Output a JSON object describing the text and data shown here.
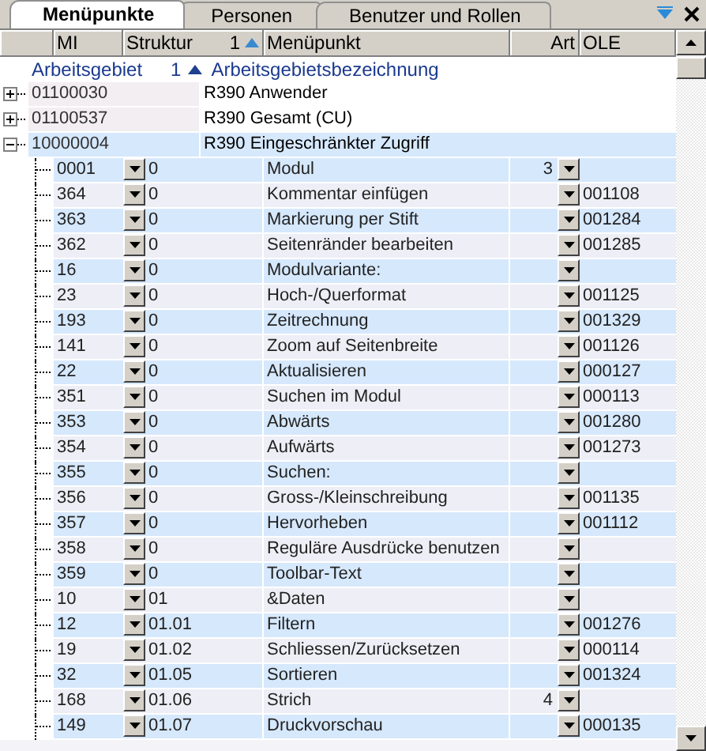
{
  "tabs": [
    {
      "label": "Menüpunkte",
      "selected": true
    },
    {
      "label": "Personen",
      "selected": false
    },
    {
      "label": "Benutzer und Rollen",
      "selected": false
    }
  ],
  "columns": [
    {
      "label": "MI"
    },
    {
      "label": "Struktur",
      "sort_index": "1"
    },
    {
      "label": "Menüpunkt"
    },
    {
      "label": "Art"
    },
    {
      "label": "OLE"
    }
  ],
  "group_header": {
    "code": "Arbeitsgebiet",
    "sort_index": "1",
    "name": "Arbeitsgebietsbezeichnung"
  },
  "groups": [
    {
      "code": "01100030",
      "name": "R390 Anwender",
      "expanded": false
    },
    {
      "code": "01100537",
      "name": "R390 Gesamt (CU)",
      "expanded": false
    },
    {
      "code": "10000004",
      "name": "R390 Eingeschränkter Zugriff",
      "expanded": true,
      "children": [
        {
          "mi": "0001",
          "struktur": "0",
          "menupunkt": "Modul",
          "art": "3"
        },
        {
          "mi": "364",
          "struktur": "0",
          "menupunkt": "Kommentar einfügen",
          "ole": "001108"
        },
        {
          "mi": "363",
          "struktur": "0",
          "menupunkt": "Markierung per Stift",
          "ole": "001284"
        },
        {
          "mi": "362",
          "struktur": "0",
          "menupunkt": "Seitenränder bearbeiten",
          "ole": "001285"
        },
        {
          "mi": "16",
          "struktur": "0",
          "menupunkt": "Modulvariante:"
        },
        {
          "mi": "23",
          "struktur": "0",
          "menupunkt": "Hoch-/Querformat",
          "ole": "001125"
        },
        {
          "mi": "193",
          "struktur": "0",
          "menupunkt": "Zeitrechnung",
          "ole": "001329"
        },
        {
          "mi": "141",
          "struktur": "0",
          "menupunkt": "Zoom auf Seitenbreite",
          "ole": "001126"
        },
        {
          "mi": "22",
          "struktur": "0",
          "menupunkt": "Aktualisieren",
          "ole": "000127"
        },
        {
          "mi": "351",
          "struktur": "0",
          "menupunkt": "Suchen im Modul",
          "ole": "000113"
        },
        {
          "mi": "353",
          "struktur": "0",
          "menupunkt": "Abwärts",
          "ole": "001280"
        },
        {
          "mi": "354",
          "struktur": "0",
          "menupunkt": "Aufwärts",
          "ole": "001273"
        },
        {
          "mi": "355",
          "struktur": "0",
          "menupunkt": "Suchen:"
        },
        {
          "mi": "356",
          "struktur": "0",
          "menupunkt": "Gross-/Kleinschreibung",
          "ole": "001135"
        },
        {
          "mi": "357",
          "struktur": "0",
          "menupunkt": "Hervorheben",
          "ole": "001112"
        },
        {
          "mi": "358",
          "struktur": "0",
          "menupunkt": "Reguläre Ausdrücke benutzen"
        },
        {
          "mi": "359",
          "struktur": "0",
          "menupunkt": "Toolbar-Text"
        },
        {
          "mi": "10",
          "struktur": "01",
          "menupunkt": "&Daten"
        },
        {
          "mi": "12",
          "struktur": "01.01",
          "menupunkt": "Filtern",
          "ole": "001276"
        },
        {
          "mi": "19",
          "struktur": "01.02",
          "menupunkt": "Schliessen/Zurücksetzen",
          "ole": "000114"
        },
        {
          "mi": "32",
          "struktur": "01.05",
          "menupunkt": "Sortieren",
          "ole": "001324"
        },
        {
          "mi": "168",
          "struktur": "01.06",
          "menupunkt": "Strich",
          "art": "4"
        },
        {
          "mi": "149",
          "struktur": "01.07",
          "menupunkt": "Druckvorschau",
          "ole": "000135"
        }
      ]
    }
  ]
}
